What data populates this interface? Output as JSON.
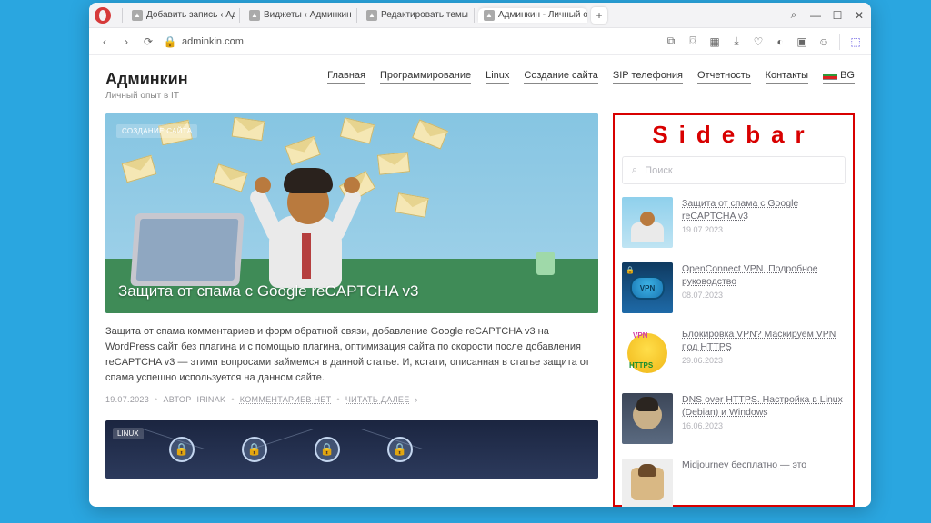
{
  "browser": {
    "tabs": [
      {
        "label": "Добавить запись ‹ Админ"
      },
      {
        "label": "Виджеты ‹ Админкин —"
      },
      {
        "label": "Редактировать темы ‹ Ад"
      },
      {
        "label": "Админкин - Личный опы",
        "active": true
      }
    ],
    "url_host": "adminkin.com",
    "icons": {
      "back": "‹",
      "forward": "›",
      "reload": "⟳",
      "lock": "🔒",
      "newtab": "+",
      "search": "⌕",
      "minimize": "—",
      "maximize": "☐",
      "close": "✕",
      "box": "⧉",
      "camera": "⌼",
      "qr": "▦",
      "download": "⤓",
      "heart": "♡",
      "toggle": "◐",
      "shield": "▣",
      "user": "☺",
      "cube": "⬚"
    }
  },
  "site": {
    "title": "Админкин",
    "tagline": "Личный опыт в IT",
    "nav": [
      "Главная",
      "Программирование",
      "Linux",
      "Создание сайта",
      "SIP телефония",
      "Отчетность",
      "Контакты"
    ],
    "lang_label": "BG"
  },
  "hero": {
    "category": "СОЗДАНИЕ САЙТА",
    "title": "Защита от спама с Google reCAPTCHA v3",
    "excerpt": "Защита от спама комментариев и форм обратной связи, добавление Google reCAPTCHA v3 на WordPress сайт без плагина и с помощью плагина, оптимизация сайта по скорости после добавления reCAPTCHA v3 — этими вопросами займемся в данной статье. И, кстати, описанная в статье защита от спама успешно используется на данном сайте.",
    "meta": {
      "date": "19.07.2023",
      "author_prefix": "АВТОР",
      "author": "IRINAK",
      "comments": "КОММЕНТАРИЕВ НЕТ",
      "readmore": "ЧИТАТЬ ДАЛЕЕ"
    }
  },
  "second": {
    "category": "LINUX"
  },
  "sidebar": {
    "annotation": "Sidebar",
    "search_placeholder": "Поиск",
    "items": [
      {
        "title": "Защита от спама с Google reCAPTCHA v3",
        "date": "19.07.2023"
      },
      {
        "title": "OpenConnect VPN. Подробное руководство",
        "date": "08.07.2023"
      },
      {
        "title": "Блокировка VPN? Маскируем VPN под HTTPS",
        "date": "29.06.2023"
      },
      {
        "title": "DNS over HTTPS. Настройка в Linux (Debian) и Windows",
        "date": "16.06.2023"
      },
      {
        "title": "Midjourney бесплатно — это",
        "date": ""
      }
    ]
  }
}
